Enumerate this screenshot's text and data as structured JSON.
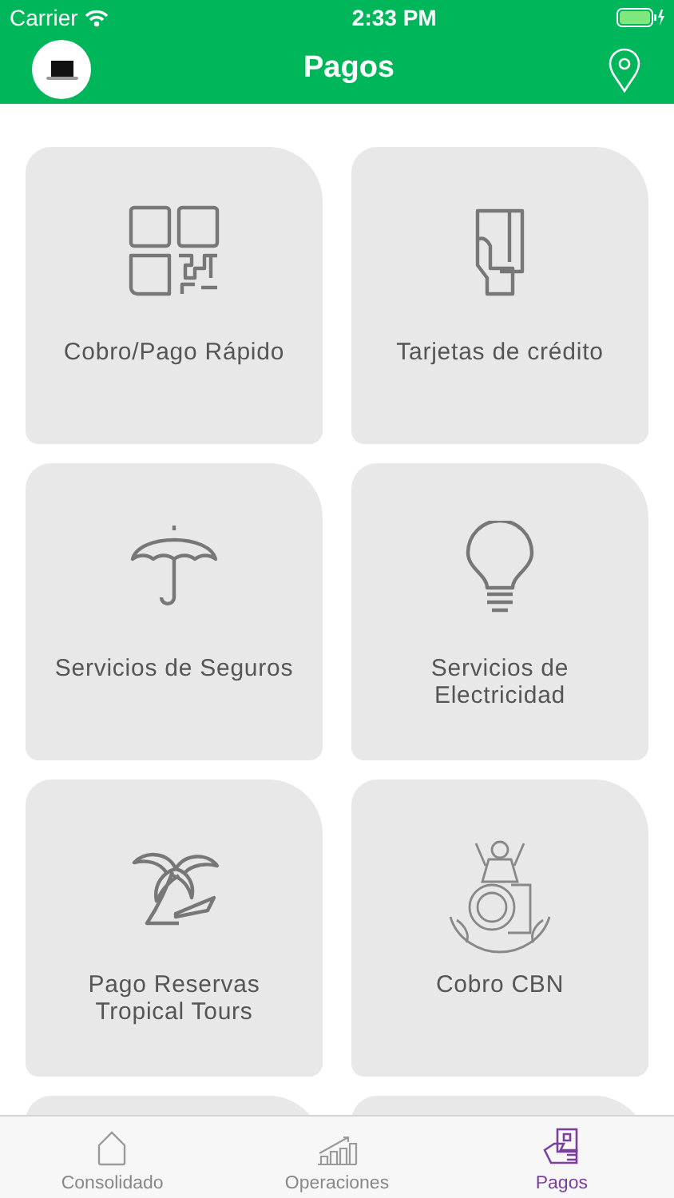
{
  "status_bar": {
    "carrier": "Carrier",
    "time": "2:33 PM"
  },
  "header": {
    "title": "Pagos"
  },
  "tiles": [
    {
      "label": "Cobro/Pago Rápido"
    },
    {
      "label": "Tarjetas de crédito"
    },
    {
      "label": "Servicios de Seguros"
    },
    {
      "label": "Servicios de Electricidad"
    },
    {
      "label": "Pago Reservas Tropical Tours"
    },
    {
      "label": "Cobro CBN"
    }
  ],
  "tab_bar": [
    {
      "label": "Consolidado",
      "selected": false
    },
    {
      "label": "Operaciones",
      "selected": false
    },
    {
      "label": "Pagos",
      "selected": true
    }
  ]
}
